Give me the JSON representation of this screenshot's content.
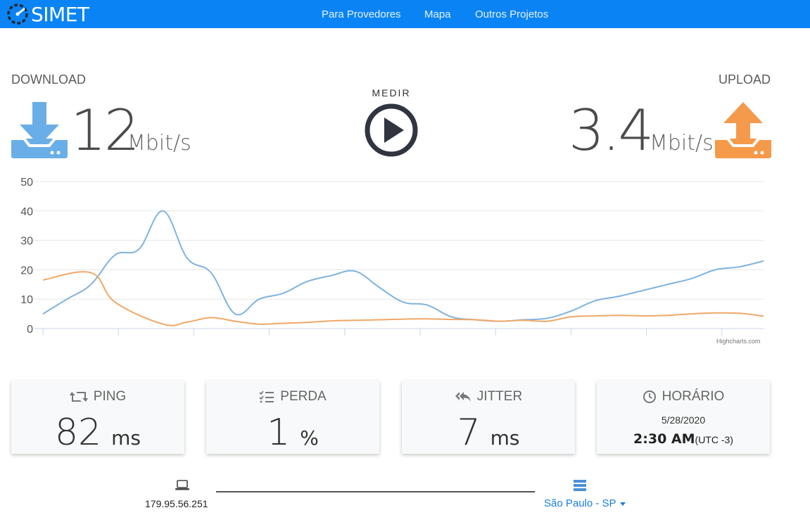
{
  "nav": {
    "logo_text": "SIMET",
    "links": [
      "Para Provedores",
      "Mapa",
      "Outros Projetos"
    ]
  },
  "download": {
    "label": "DOWNLOAD",
    "value": "12",
    "unit": "Mbit/s",
    "color": "#6aaee8"
  },
  "upload": {
    "label": "UPLOAD",
    "value": "3.4",
    "unit": "Mbit/s",
    "color": "#f59a4a"
  },
  "medir": {
    "label": "MEDIR"
  },
  "chart_data": {
    "type": "line",
    "ylim": [
      0,
      50
    ],
    "yticks": [
      "0",
      "10",
      "20",
      "30",
      "40",
      "50"
    ],
    "credit": "Highcharts.com",
    "series": [
      {
        "color": "#7fb3e0",
        "x": [
          0,
          1,
          2,
          3,
          4,
          5,
          6,
          7,
          8,
          9,
          10,
          11,
          12,
          13,
          14,
          15,
          16,
          17,
          18,
          19,
          20,
          21,
          22,
          23,
          24,
          25,
          26,
          27,
          28,
          29,
          30
        ],
        "values": [
          5,
          10,
          15,
          25,
          27,
          40,
          24,
          19,
          5,
          10,
          12,
          16,
          18,
          19.5,
          14,
          9,
          8,
          4,
          3,
          2.5,
          3,
          3.5,
          6,
          9.5,
          11,
          13,
          15,
          17,
          20,
          21,
          23
        ]
      },
      {
        "color": "#f0a868",
        "x": [
          0,
          2,
          3,
          5,
          6,
          7,
          8,
          9,
          10,
          11,
          12,
          13,
          14,
          15,
          16,
          17,
          18,
          19,
          20,
          21,
          22,
          23,
          24,
          25,
          26,
          27,
          28,
          29,
          30
        ],
        "values": [
          16.5,
          19,
          9,
          1.5,
          2.2,
          3.7,
          2.5,
          1.5,
          1.8,
          2.1,
          2.6,
          2.8,
          3,
          3.2,
          3.3,
          3.1,
          3,
          2.5,
          2.8,
          2.5,
          4,
          4.3,
          4.5,
          4.3,
          4.5,
          5,
          5.3,
          5.2,
          4.2
        ]
      }
    ]
  },
  "cards": [
    {
      "title": "PING",
      "value": "82",
      "unit": "ms",
      "icon": "retweet-icon"
    },
    {
      "title": "PERDA",
      "value": "1",
      "unit": "%",
      "icon": "tasks-icon"
    },
    {
      "title": "JITTER",
      "value": "7",
      "unit": "ms",
      "icon": "reply-all-icon"
    },
    {
      "title": "HORÁRIO",
      "date": "5/28/2020",
      "time": "2:30 AM",
      "tz": "(UTC -3)",
      "icon": "clock-icon"
    }
  ],
  "footer": {
    "ip": "179.95.56.251",
    "city": "São Paulo - SP"
  }
}
